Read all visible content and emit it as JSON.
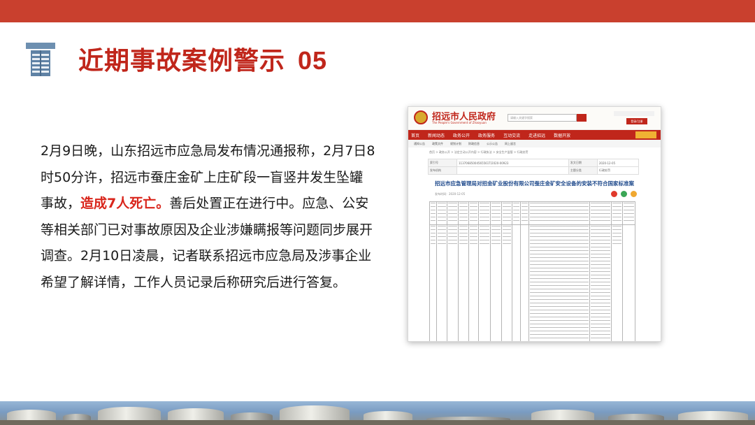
{
  "slide": {
    "title": "近期事故案例警示",
    "title_number": "05",
    "accent_color": "#c0261b",
    "header_bar_color": "#c9402e",
    "logo_icon": "industrial-tower-icon"
  },
  "body": {
    "text_before_highlight": "2月9日晚，山东招远市应急局发布情况通报称，2月7日8时50分许，招远市蚕庄金矿上庄矿段一盲竖井发生坠罐事故，",
    "highlight": "造成7人死亡。",
    "text_after_highlight": "善后处置正在进行中。应急、公安等相关部门已对事故原因及企业涉嫌瞒报等问题同步展开调查。2月10日凌晨，记者联系招远市应急局及涉事企业希望了解详情，工作人员记录后称研究后进行答复。",
    "highlight_color": "#d9261c"
  },
  "screenshot": {
    "site_name": "招远市人民政府",
    "site_subtitle": "The People's Government of Zhaoyuan",
    "search_placeholder": "请输入关键字搜索",
    "login_label": "登录/注册",
    "nav": [
      "首页",
      "新闻动态",
      "政务公开",
      "政务服务",
      "互动交流",
      "走进招远",
      "数据开放"
    ],
    "subnav": [
      "通知公告",
      "政策文件",
      "规划计划",
      "财政信息",
      "公示公告",
      "网上留言"
    ],
    "breadcrumb": "首页 > 政务公开 > 法定主动公开内容 > 行政执法 > 安全生产监管 > 行政处罚",
    "meta": [
      {
        "label": "索引号",
        "value": "11370685004565561T/2020-00923",
        "label2": "发文日期",
        "value2": "2020-12-05"
      },
      {
        "label": "发布机构",
        "value": "",
        "label2": "主题分类",
        "value2": "行政处罚"
      }
    ],
    "doc_title": "招远市应急管理局对招金矿业股份有限公司蚕庄金矿安全设备的安装不符合国家标准案",
    "doc_date": "发布时间：2020-12-05",
    "share_colors": [
      "#e0392b",
      "#3aa655",
      "#f0a830"
    ]
  }
}
